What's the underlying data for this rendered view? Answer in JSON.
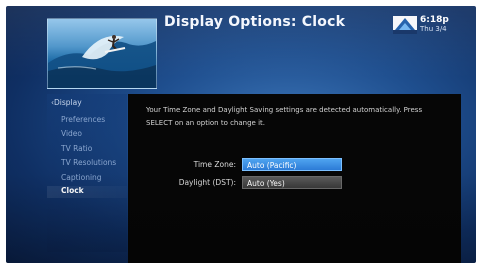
{
  "header": {
    "title": "Display Options: Clock",
    "time": "6:18p",
    "date": "Thu 3/4",
    "logo_icon": "directv-logo-icon"
  },
  "sidebar": {
    "back_label": "Display",
    "items": [
      {
        "label": "Preferences"
      },
      {
        "label": "Video"
      },
      {
        "label": "TV Ratio"
      },
      {
        "label": "TV Resolutions"
      },
      {
        "label": "Captioning"
      },
      {
        "label": "Clock",
        "selected": true
      }
    ]
  },
  "main": {
    "message": "Your Time Zone and Daylight Saving settings are detected automatically. Press SELECT on an option to change it.",
    "settings": [
      {
        "label": "Time Zone:",
        "value": "Auto (Pacific)",
        "focused": true
      },
      {
        "label": "Daylight (DST):",
        "value": "Auto (Yes)",
        "focused": false
      }
    ]
  },
  "colors": {
    "background_blue": "#1f4f8f",
    "focus_blue": "#2c7bd6",
    "panel_black": "#060606"
  }
}
